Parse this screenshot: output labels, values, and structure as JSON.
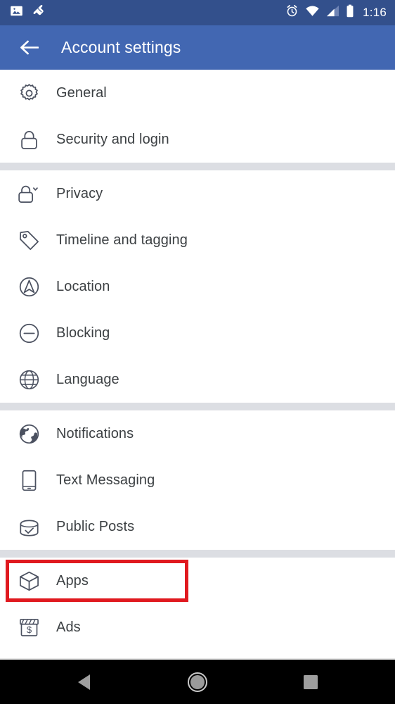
{
  "statusbar": {
    "time": "1:16",
    "left_icons": [
      {
        "name": "image-icon"
      },
      {
        "name": "shoe-icon"
      }
    ],
    "right_icons": [
      {
        "name": "alarm-clock-icon"
      },
      {
        "name": "wifi-icon"
      },
      {
        "name": "cellular-signal-icon"
      },
      {
        "name": "battery-icon"
      }
    ],
    "bg_color": "#33508C"
  },
  "appbar": {
    "title": "Account settings",
    "back_icon": "arrow-left-icon",
    "bg_color": "#4267B2",
    "text_color": "#FFFFFF"
  },
  "settings": {
    "groups": [
      {
        "items": [
          {
            "label": "General",
            "icon": "gear-icon"
          },
          {
            "label": "Security and login",
            "icon": "lock-icon"
          }
        ]
      },
      {
        "items": [
          {
            "label": "Privacy",
            "icon": "lock-chevron-icon"
          },
          {
            "label": "Timeline and tagging",
            "icon": "tag-icon"
          },
          {
            "label": "Location",
            "icon": "navigation-arrow-icon"
          },
          {
            "label": "Blocking",
            "icon": "minus-circle-icon"
          },
          {
            "label": "Language",
            "icon": "globe-icon"
          }
        ]
      },
      {
        "items": [
          {
            "label": "Notifications",
            "icon": "world-icon"
          },
          {
            "label": "Text Messaging",
            "icon": "phone-icon"
          },
          {
            "label": "Public Posts",
            "icon": "public-posts-icon"
          }
        ]
      },
      {
        "items": [
          {
            "label": "Apps",
            "icon": "cube-icon",
            "highlighted": true
          },
          {
            "label": "Ads",
            "icon": "storefront-dollar-icon"
          }
        ]
      }
    ]
  },
  "highlight": {
    "color": "#E0191F",
    "target": "Apps"
  },
  "navbar": {
    "buttons": [
      {
        "name": "back-nav-button",
        "icon": "triangle-left-icon"
      },
      {
        "name": "home-nav-button",
        "icon": "circle-icon"
      },
      {
        "name": "recents-nav-button",
        "icon": "square-icon"
      }
    ],
    "bg_color": "#000000"
  },
  "colors": {
    "list_text": "#3C4043",
    "icon_stroke": "#4B5160",
    "separator": "#DCDEE3"
  }
}
